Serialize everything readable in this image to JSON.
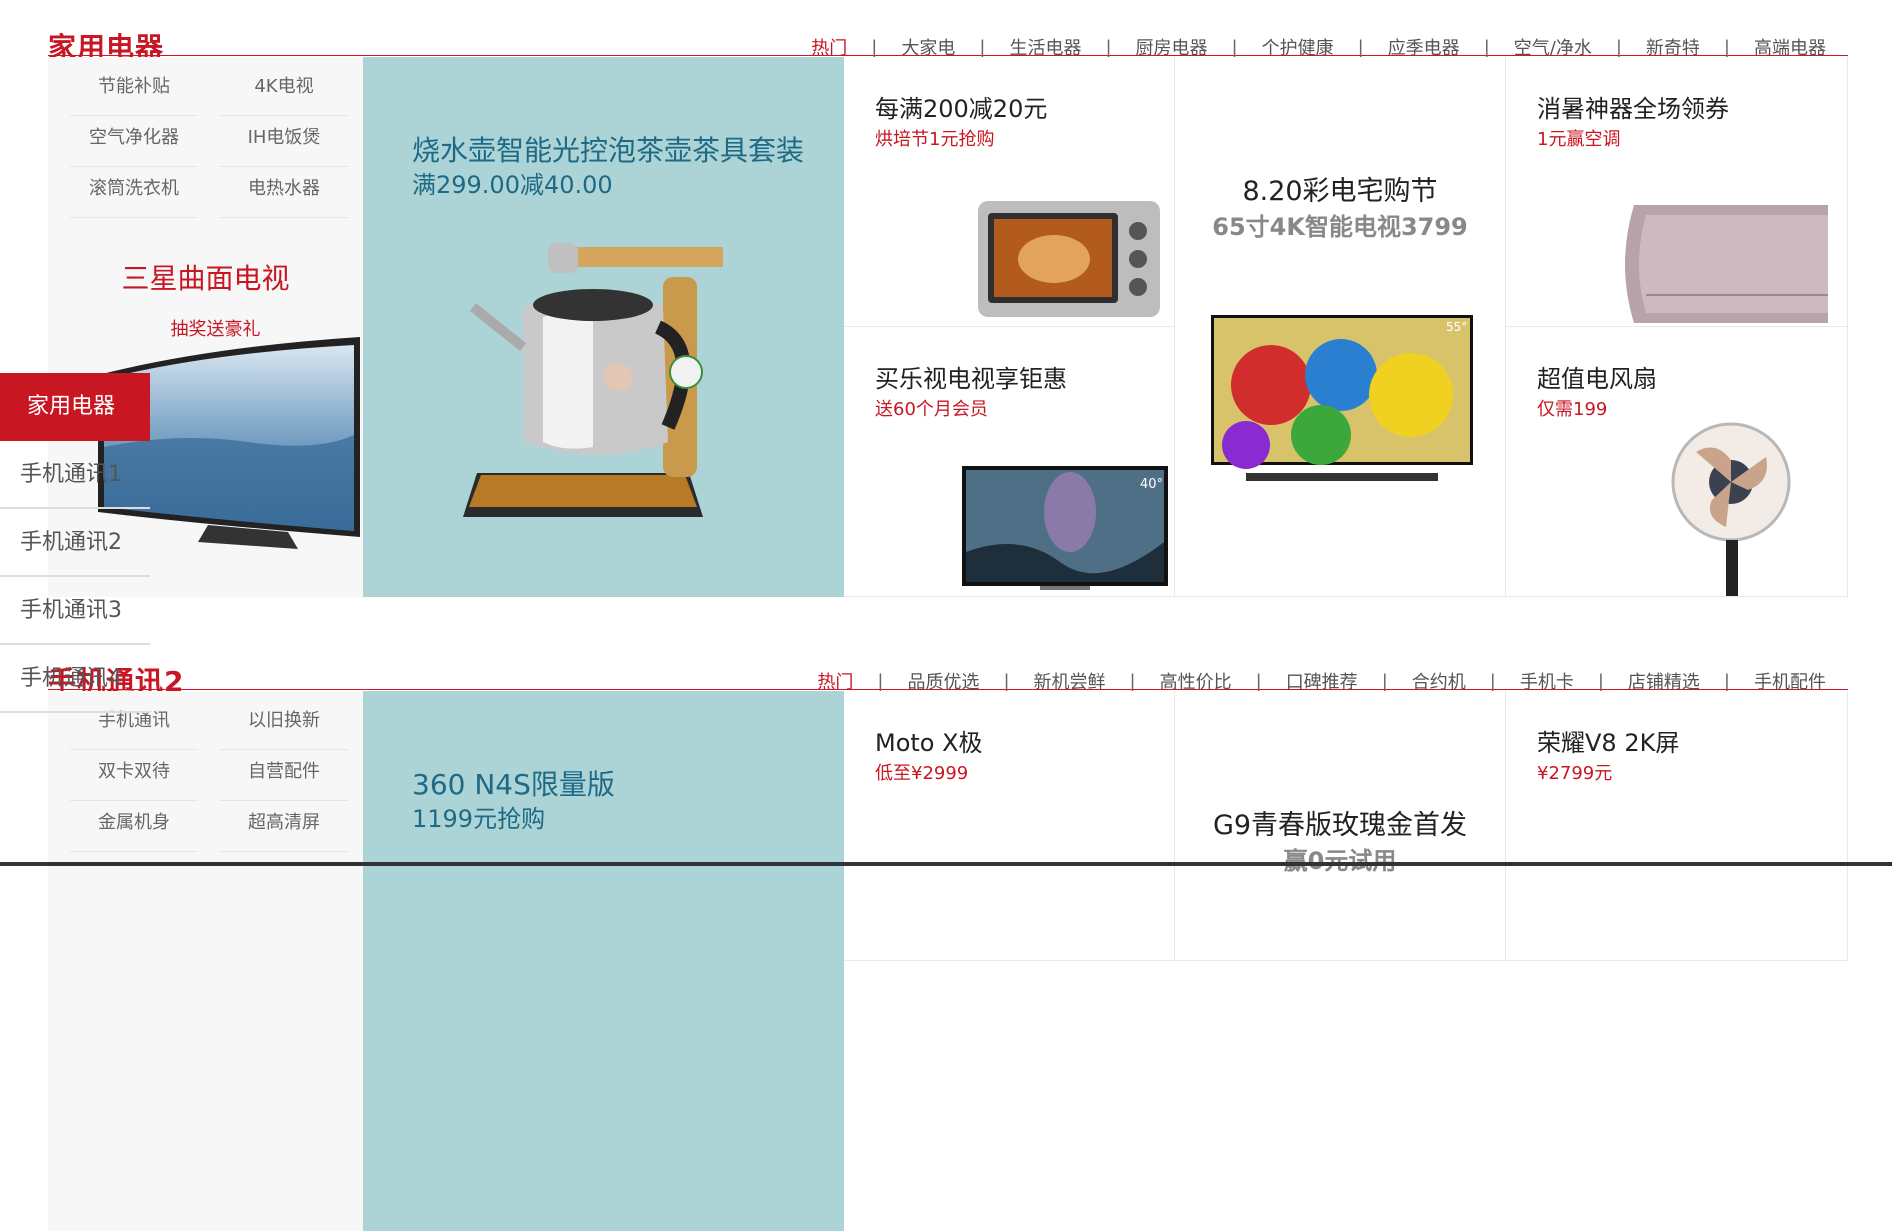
{
  "floor1": {
    "title": "家用电器",
    "tabs": [
      "热门",
      "大家电",
      "生活电器",
      "厨房电器",
      "个护健康",
      "应季电器",
      "空气/净水",
      "新奇特",
      "高端电器"
    ],
    "keywords": [
      "节能补贴",
      "4K电视",
      "空气净化器",
      "IH电饭煲",
      "滚筒洗衣机",
      "电热水器"
    ],
    "promo_title": "三星曲面电视",
    "promo_subtitle": "抽奖送豪礼",
    "feature_title": "烧水壶智能光控泡茶壶茶具套装",
    "feature_subtitle": "满299.00减40.00",
    "cells": [
      {
        "title": "每满200减20元",
        "subtitle": "烘培节1元抢购"
      },
      {
        "title": "买乐视电视享钜惠",
        "subtitle": "送60个月会员"
      },
      {
        "title": "消暑神器全场领券",
        "subtitle": "1元赢空调"
      },
      {
        "title": "超值电风扇",
        "subtitle": "仅需199"
      }
    ],
    "center_title": "8.20彩电宅购节",
    "center_subtitle": "65寸4K智能电视3799",
    "tv_badge_55": "55°",
    "tv_badge_40": "40°"
  },
  "floor2": {
    "title": "手机通讯2",
    "tabs": [
      "热门",
      "品质优选",
      "新机尝鲜",
      "高性价比",
      "口碑推荐",
      "合约机",
      "手机卡",
      "店铺精选",
      "手机配件"
    ],
    "keywords": [
      "手机通讯",
      "以旧换新",
      "双卡双待",
      "自营配件",
      "金属机身",
      "超高清屏"
    ],
    "feature_title": "360 N4S限量版",
    "feature_subtitle": "1199元抢购",
    "cells": [
      {
        "title": "Moto X极",
        "subtitle": "低至¥2999"
      },
      {
        "title": "荣耀V8 2K屏",
        "subtitle": "¥2799元"
      }
    ],
    "center_title": "G9青春版玫瑰金首发",
    "center_subtitle": "赢0元试用"
  },
  "side_nav": [
    "家用电器",
    "手机通讯1",
    "手机通讯2",
    "手机通讯3",
    "手机通讯4"
  ],
  "colors": {
    "accent": "#c81623",
    "feature_bg": "#acd4d6",
    "feature_text": "#1e6a86"
  }
}
